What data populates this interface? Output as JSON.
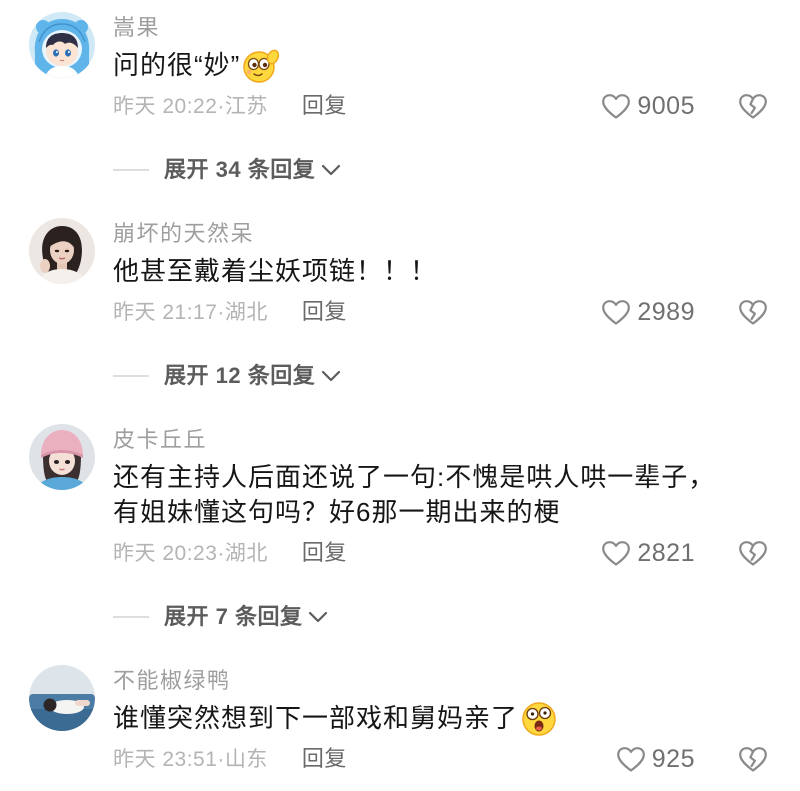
{
  "comments": [
    {
      "username": "嵩果",
      "text_lines": [
        "问的很“妙”"
      ],
      "emoji_icon": "giggle-face-emoji",
      "time_location": "昨天 20:22·江苏",
      "reply_label": "回复",
      "likes": "9005",
      "expand_label": "展开 34 条回复"
    },
    {
      "username": "崩坏的天然呆",
      "text_lines": [
        "他甚至戴着尘妖项链！！！"
      ],
      "time_location": "昨天 21:17·湖北",
      "reply_label": "回复",
      "likes": "2989",
      "expand_label": "展开 12 条回复"
    },
    {
      "username": "皮卡丘丘",
      "text_lines": [
        "还有主持人后面还说了一句:不愧是哄人哄一辈子，",
        "有姐妹懂这句吗？好6那一期出来的梗"
      ],
      "time_location": "昨天 20:23·湖北",
      "reply_label": "回复",
      "likes": "2821",
      "expand_label": "展开 7 条回复"
    },
    {
      "username": "不能椒绿鸭",
      "text_lines": [
        "谁懂突然想到下一部戏和舅妈亲了"
      ],
      "emoji_icon": "shocked-face-emoji",
      "time_location": "昨天 23:51·山东",
      "reply_label": "回复",
      "likes": "925"
    }
  ],
  "icons": {
    "like": "heart-outline-icon",
    "dislike": "broken-heart-icon",
    "expand": "chevron-down-icon"
  },
  "colors": {
    "background": "#ffffff",
    "comment_text": "#161616",
    "username": "#9e9e9e",
    "meta": "#b4b4b4",
    "reply": "#6a6a6a",
    "likes": "#707070",
    "expand": "#5c5c5c",
    "icon_stroke": "#8a8a8a"
  }
}
